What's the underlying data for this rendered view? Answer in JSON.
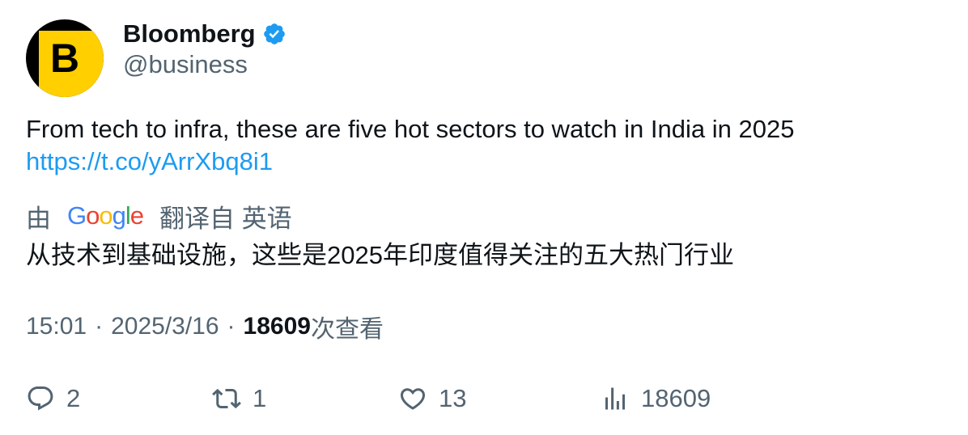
{
  "author": {
    "display_name": "Bloomberg",
    "handle": "@business",
    "avatar_letter": "B",
    "verified": true
  },
  "tweet": {
    "text": "From tech to infra, these are five hot sectors to watch in India in 2025",
    "link": "https://t.co/yArrXbq8i1"
  },
  "translation": {
    "prefix": "由",
    "provider": "Google",
    "suffix": "翻译自 英语",
    "text": "从技术到基础设施，这些是2025年印度值得关注的五大热门行业"
  },
  "meta": {
    "time": "15:01",
    "date": "2025/3/16",
    "separator": "·",
    "views_count": "18609",
    "views_label": "次查看"
  },
  "actions": {
    "replies": "2",
    "retweets": "1",
    "likes": "13",
    "views": "18609"
  },
  "icons": {
    "reply": "reply-icon",
    "retweet": "retweet-icon",
    "like": "heart-icon",
    "views": "analytics-icon",
    "verified": "verified-badge-icon"
  },
  "colors": {
    "accent": "#1d9bf0",
    "secondary_text": "#536471",
    "avatar_yellow": "#ffcf00",
    "google_blue": "#4285F4",
    "google_red": "#EA4335",
    "google_yellow": "#FBBC05",
    "google_green": "#34A853"
  }
}
